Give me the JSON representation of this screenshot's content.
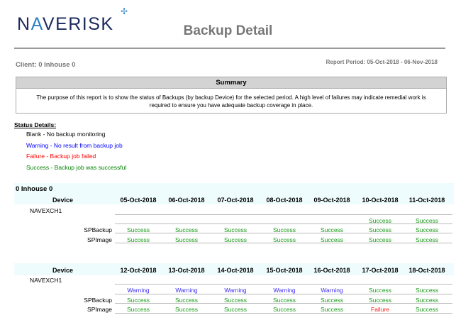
{
  "header": {
    "logo_pre": "N",
    "logo_a": "A",
    "logo_post": "VERISK",
    "title": "Backup Detail",
    "client": "Client: 0 Inhouse 0",
    "period": "Report Period: 05-Oct-2018 - 06-Nov-2018"
  },
  "summary": {
    "heading": "Summary",
    "text": "The purpose of this report is to show the status of Backups (by backup Device) for the selected period. A high level of failures may indicate remedial work is required to ensure you have adequate backup coverage in place."
  },
  "status_details": {
    "heading": "Status Details:",
    "items": [
      {
        "text": "Blank - No backup monitoring",
        "color": "#000000"
      },
      {
        "text": "Warning - No result from backup job",
        "color": "#0000ff"
      },
      {
        "text": "Failure - Backup job failed",
        "color": "#ff0000"
      },
      {
        "text": "Success - Backup job was successful",
        "color": "#008000"
      }
    ]
  },
  "group": "0 Inhouse 0",
  "colors": {
    "Success": "#1a9a1a",
    "Warning": "#3a2af0",
    "Failure": "#ff2020"
  },
  "blocks": [
    {
      "device_label": "Device",
      "device": "NAVEXCH1",
      "dates": [
        "05-Oct-2018",
        "06-Oct-2018",
        "07-Oct-2018",
        "08-Oct-2018",
        "09-Oct-2018",
        "10-Oct-2018",
        "11-Oct-2018"
      ],
      "rows": [
        {
          "label": "",
          "values": [
            "",
            "",
            "",
            "",
            "",
            "Success",
            "Success"
          ]
        },
        {
          "label": "SPBackup",
          "values": [
            "Success",
            "Success",
            "Success",
            "Success",
            "Success",
            "Success",
            "Success"
          ]
        },
        {
          "label": "SPImage",
          "values": [
            "Success",
            "Success",
            "Success",
            "Success",
            "Success",
            "Success",
            "Success"
          ]
        }
      ]
    },
    {
      "device_label": "Device",
      "device": "NAVEXCH1",
      "dates": [
        "12-Oct-2018",
        "13-Oct-2018",
        "14-Oct-2018",
        "15-Oct-2018",
        "16-Oct-2018",
        "17-Oct-2018",
        "18-Oct-2018"
      ],
      "rows": [
        {
          "label": "",
          "values": [
            "Warning",
            "Warning",
            "Warning",
            "Warning",
            "Warning",
            "Success",
            "Success"
          ]
        },
        {
          "label": "SPBackup",
          "values": [
            "Success",
            "Success",
            "Success",
            "Success",
            "Success",
            "Success",
            "Success"
          ]
        },
        {
          "label": "SPImage",
          "values": [
            "Success",
            "Success",
            "Success",
            "Success",
            "Success",
            "Failure",
            "Success"
          ]
        }
      ]
    }
  ]
}
